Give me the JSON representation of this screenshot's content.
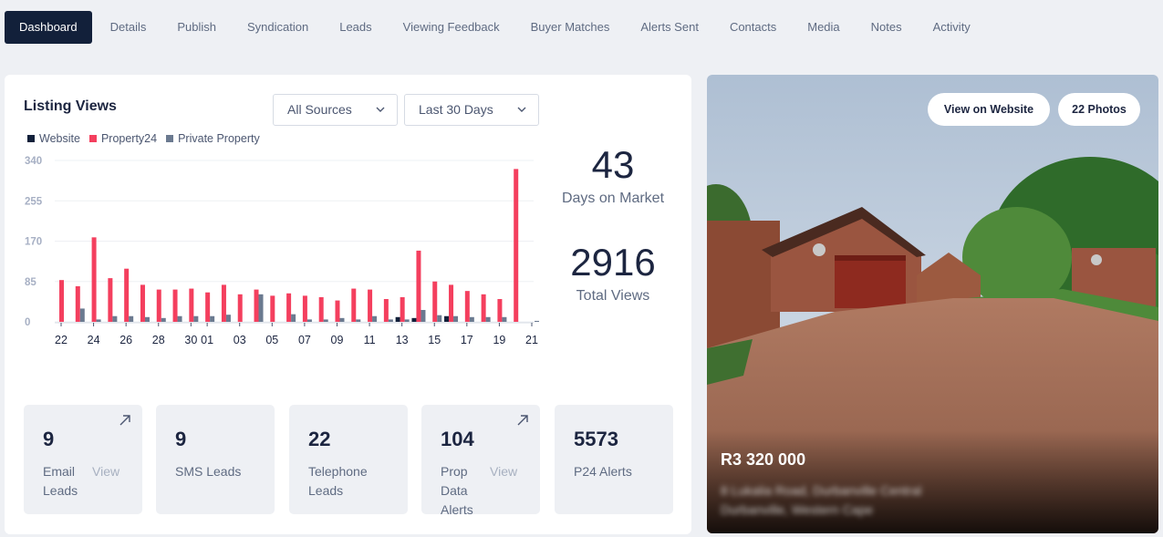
{
  "tabs": [
    {
      "label": "Dashboard",
      "active": true
    },
    {
      "label": "Details"
    },
    {
      "label": "Publish"
    },
    {
      "label": "Syndication"
    },
    {
      "label": "Leads"
    },
    {
      "label": "Viewing Feedback"
    },
    {
      "label": "Buyer Matches"
    },
    {
      "label": "Alerts Sent"
    },
    {
      "label": "Contacts"
    },
    {
      "label": "Media"
    },
    {
      "label": "Notes"
    },
    {
      "label": "Activity"
    }
  ],
  "listing_views": {
    "title": "Listing Views",
    "source_filter": "All Sources",
    "period_filter": "Last 30 Days"
  },
  "stats": {
    "days_on_market": {
      "value": "43",
      "label": "Days on Market"
    },
    "total_views": {
      "value": "2916",
      "label": "Total Views"
    }
  },
  "tiles": [
    {
      "value": "9",
      "label": "Email\nLeads",
      "view": "View",
      "link": true
    },
    {
      "value": "9",
      "label": "SMS Leads"
    },
    {
      "value": "22",
      "label": "Telephone\nLeads"
    },
    {
      "value": "104",
      "label": "Prop\nData\nAlerts",
      "view": "View",
      "link": true
    },
    {
      "value": "5573",
      "label": "P24 Alerts"
    }
  ],
  "property": {
    "view_website_label": "View on Website",
    "photos_label": "22 Photos",
    "price": "R3 320 000",
    "address_line1": "8 Lukalia Road, Durbanville Central",
    "address_line2": "Durbanville, Western Cape"
  },
  "colors": {
    "website": "#12203a",
    "property24": "#f43f5e",
    "private_property": "#6b7a90",
    "active_tab": "#12203a"
  },
  "chart_data": {
    "type": "bar",
    "title": "Listing Views",
    "xlabel": "",
    "ylabel": "",
    "ylim": [
      0,
      340
    ],
    "yticks": [
      0,
      85,
      170,
      255,
      340
    ],
    "legend_position": "top-left",
    "grid": true,
    "categories": [
      "22",
      "23",
      "24",
      "25",
      "26",
      "27",
      "28",
      "29",
      "30",
      "01",
      "02",
      "03",
      "04",
      "05",
      "06",
      "07",
      "08",
      "09",
      "10",
      "11",
      "12",
      "13",
      "14",
      "15",
      "16",
      "17",
      "18",
      "19",
      "20",
      "21"
    ],
    "xtick_labels": [
      "22",
      "24",
      "26",
      "28",
      "30",
      "01",
      "03",
      "05",
      "07",
      "09",
      "11",
      "13",
      "15",
      "17",
      "19",
      "21"
    ],
    "series": [
      {
        "name": "Website",
        "values": [
          0,
          0,
          0,
          0,
          0,
          0,
          0,
          0,
          0,
          0,
          0,
          0,
          0,
          0,
          0,
          0,
          0,
          0,
          0,
          0,
          0,
          10,
          8,
          0,
          12,
          0,
          0,
          0,
          0,
          0
        ]
      },
      {
        "name": "Property24",
        "values": [
          88,
          75,
          178,
          92,
          112,
          78,
          68,
          68,
          70,
          62,
          78,
          58,
          68,
          55,
          60,
          55,
          52,
          45,
          70,
          68,
          48,
          52,
          150,
          85,
          78,
          65,
          58,
          48,
          322,
          0
        ]
      },
      {
        "name": "Private Property",
        "values": [
          0,
          28,
          5,
          12,
          12,
          10,
          8,
          12,
          12,
          12,
          15,
          0,
          58,
          0,
          16,
          5,
          5,
          8,
          5,
          12,
          5,
          5,
          25,
          14,
          12,
          10,
          10,
          10,
          0,
          2
        ]
      }
    ]
  }
}
